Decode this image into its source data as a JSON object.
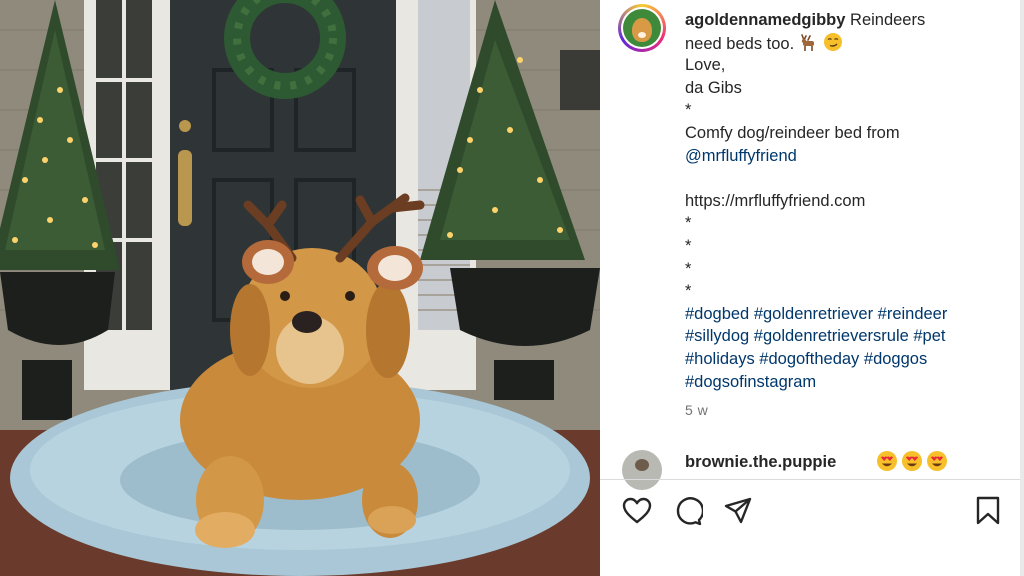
{
  "post": {
    "username": "agoldennamedgibby",
    "caption_first": " Reindeers",
    "caption_line2": "need beds too.",
    "caption_lines": [
      "Love,",
      "da Gibs",
      "*",
      "Comfy dog/reindeer bed from"
    ],
    "mention": "@mrfluffyfriend",
    "url": "https://mrfluffyfriend.com",
    "stars": [
      "*",
      "*",
      "*",
      "*"
    ],
    "hashtag_lines": [
      "#dogbed #goldenretriever #reindeer",
      "#sillydog #goldenretrieversrule #pet",
      "#holidays #dogoftheday #doggos",
      "#dogsofinstagram"
    ],
    "time_ago": "5 w"
  },
  "comment": {
    "username": "brownie.the.puppie",
    "emoji_count": 3
  },
  "icons": {
    "like": "heart-icon",
    "comment": "comment-icon",
    "share": "share-icon",
    "save": "bookmark-icon"
  },
  "colors": {
    "link": "#00376b",
    "text": "#262626",
    "muted": "#737373",
    "door": "#2f3536",
    "bed": "#a9c7d6",
    "dog": "#c98a3c"
  }
}
